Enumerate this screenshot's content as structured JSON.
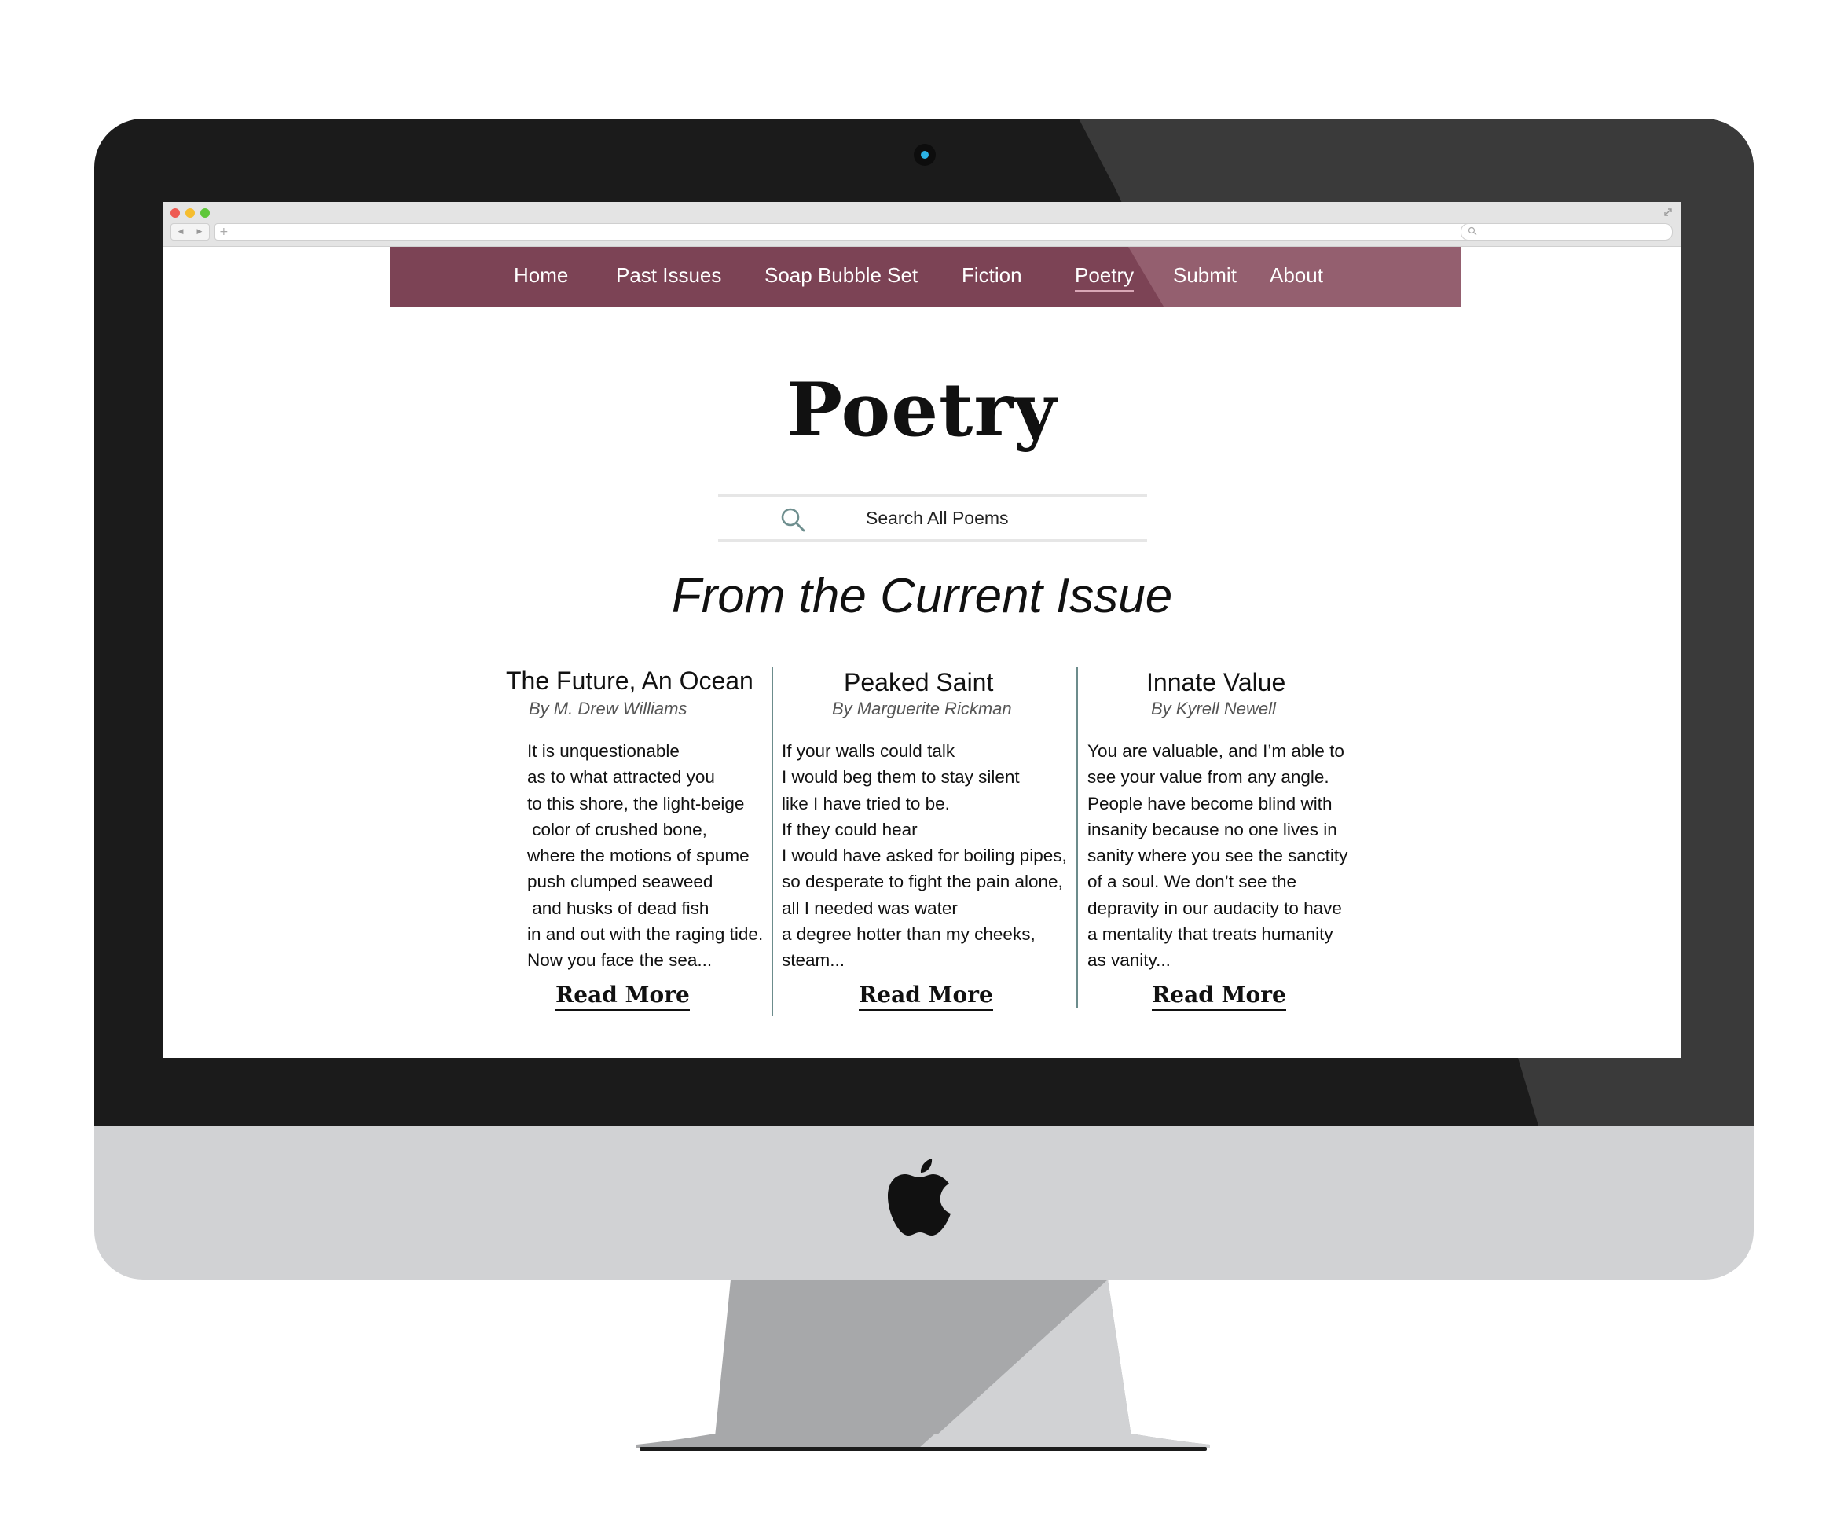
{
  "nav": {
    "items": [
      {
        "label": "Home"
      },
      {
        "label": "Past Issues"
      },
      {
        "label": "Soap Bubble Set"
      },
      {
        "label": "Fiction"
      },
      {
        "label": "Poetry",
        "active": true
      },
      {
        "label": "Submit"
      },
      {
        "label": "About"
      }
    ]
  },
  "page": {
    "title": "Poetry",
    "search_placeholder": "Search All Poems",
    "section_heading": "From the Current Issue"
  },
  "poems": [
    {
      "title": "The Future, An Ocean",
      "author": "By  M. Drew Williams",
      "excerpt": "It is unquestionable\nas to what attracted you\nto this shore, the light-beige\n color of crushed bone,\nwhere the motions of spume\npush clumped seaweed\n and husks of dead fish\nin and out with the raging tide.\nNow you face the sea...",
      "read_more": "Read More"
    },
    {
      "title": "Peaked Saint",
      "author": "By Marguerite Rickman",
      "excerpt": "If your walls could talk\nI would beg them to stay silent\nlike I have tried to be.\nIf they could hear\nI would have asked for boiling pipes,\nso desperate to fight the pain alone,\nall I needed was water\na degree hotter than my cheeks,\nsteam...",
      "read_more": "Read More"
    },
    {
      "title": "Innate Value",
      "author": "By Kyrell Newell",
      "excerpt": "You are valuable, and I’m able to\nsee your value from any angle.\nPeople have become blind with\ninsanity because no one lives in\nsanity where you see the sanctity\nof a soul. We don’t see the\ndepravity in our audacity to have\na mentality that treats humanity\nas vanity...",
      "read_more": "Read More"
    }
  ],
  "colors": {
    "nav_background": "#7c4355",
    "nav_sheen": "#945f6f",
    "active_underline": "#d9a7b6",
    "divider": "#6c8c8c",
    "bezel": "#1b1b1b",
    "chin": "#d1d2d4"
  },
  "icons": {
    "search": "search-icon",
    "apple_logo": "apple-logo-icon",
    "camera": "camera-icon",
    "expand": "expand-icon"
  }
}
